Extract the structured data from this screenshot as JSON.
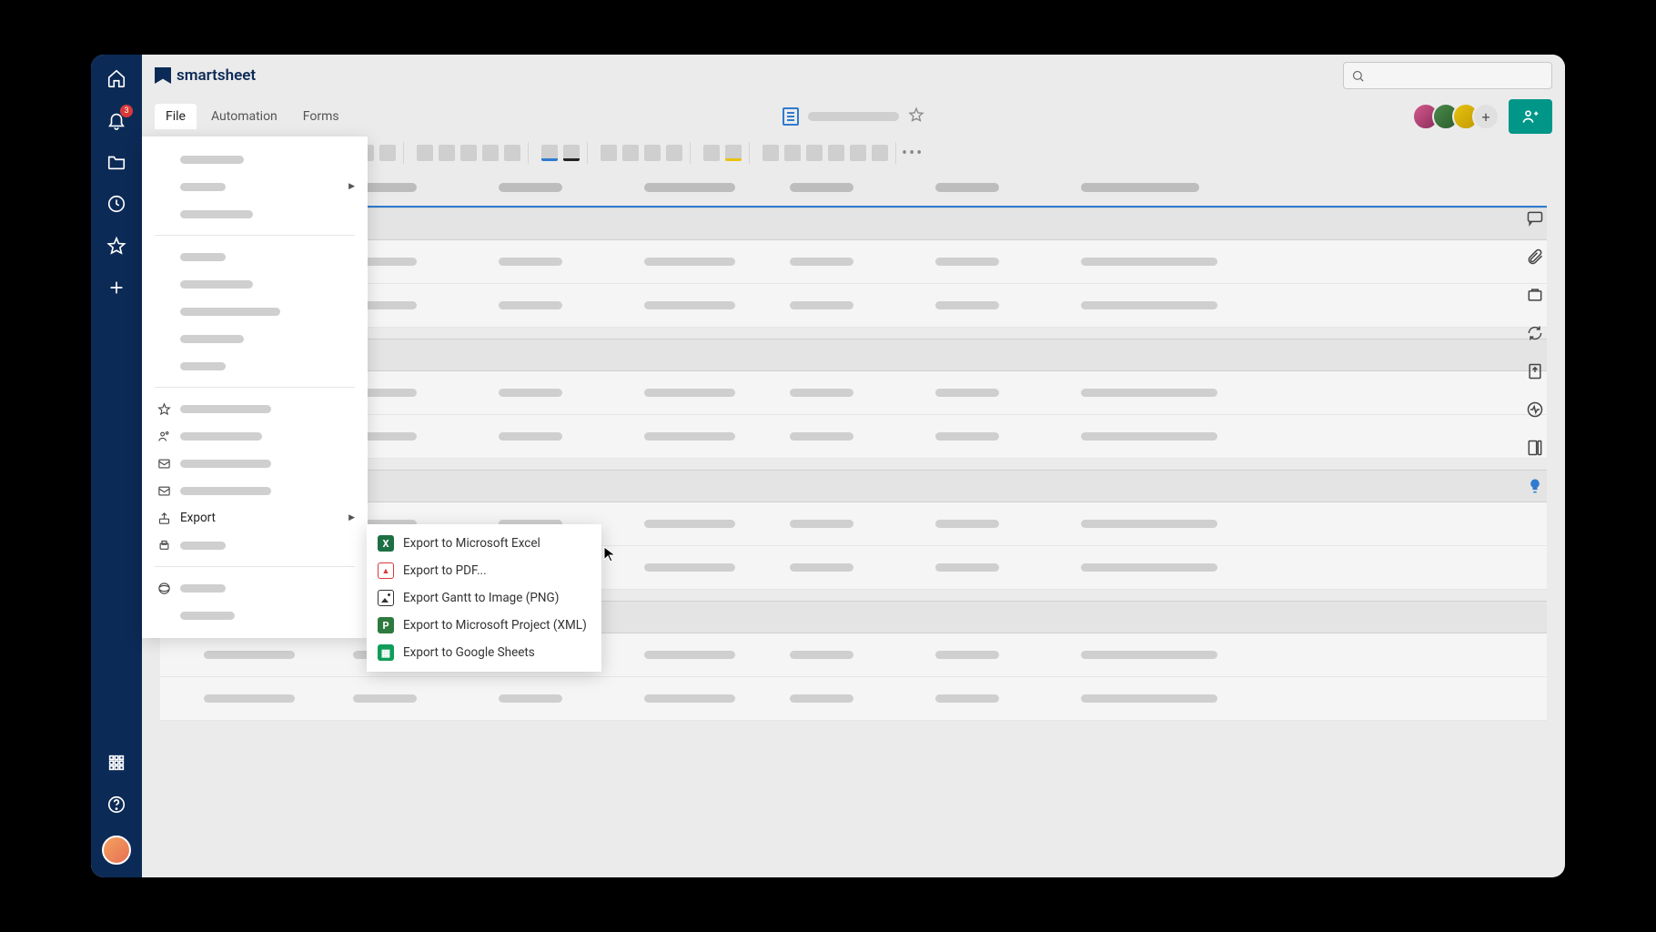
{
  "brand": {
    "name": "smartsheet"
  },
  "notifications": {
    "count": "3"
  },
  "menu": {
    "tabs": [
      "File",
      "Automation",
      "Forms"
    ],
    "active": "File"
  },
  "file_menu": {
    "export_label": "Export",
    "submenu": [
      {
        "label": "Export to Microsoft Excel",
        "icon": "excel"
      },
      {
        "label": "Export to PDF...",
        "icon": "pdf"
      },
      {
        "label": "Export Gantt to Image (PNG)",
        "icon": "img"
      },
      {
        "label": "Export to Microsoft Project (XML)",
        "icon": "proj"
      },
      {
        "label": "Export to Google Sheets",
        "icon": "gsheet"
      }
    ]
  },
  "share": {
    "avatar_add": "+"
  }
}
